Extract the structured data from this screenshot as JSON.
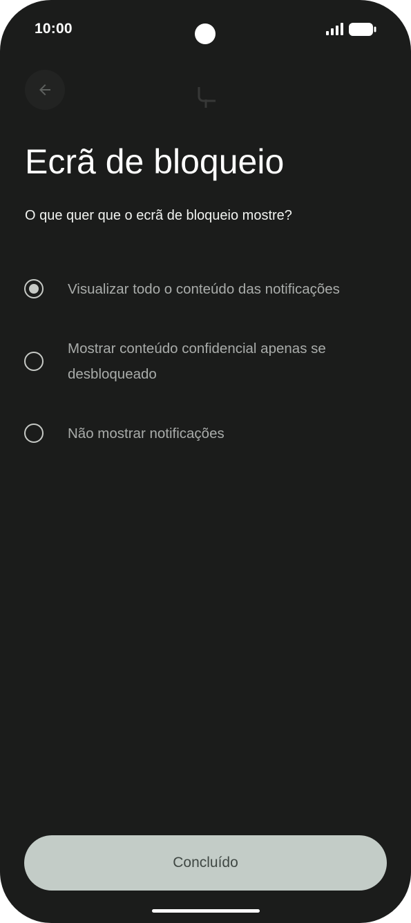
{
  "status_bar": {
    "time": "10:00",
    "icons": [
      "camera-cutout",
      "signal-icon",
      "battery-icon"
    ]
  },
  "toolbar": {
    "back_icon": "arrow-back-icon",
    "center_icon": "faded-device-icon"
  },
  "page": {
    "title": "Ecrã de bloqueio",
    "subtitle": "O que quer que o ecrã de bloqueio mostre?"
  },
  "options": [
    {
      "label": "Visualizar todo o conteúdo das notificações",
      "selected": true
    },
    {
      "label": "Mostrar conteúdo confidencial apenas se desbloqueado",
      "selected": false
    },
    {
      "label": "Não mostrar notificações",
      "selected": false
    }
  ],
  "footer": {
    "done_label": "Concluído"
  },
  "colors": {
    "background": "#1b1c1b",
    "button_background": "#c3ccc7",
    "button_text": "#404844",
    "radio": "#c6c9c5",
    "option_text": "#a9acaa"
  }
}
